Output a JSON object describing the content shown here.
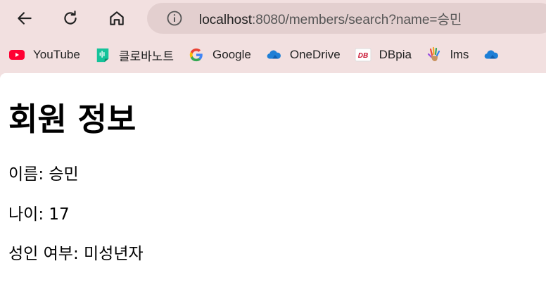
{
  "browser": {
    "url_host": "localhost",
    "url_rest": ":8080/members/search?name=승민"
  },
  "bookmarks": [
    {
      "label": "YouTube",
      "icon": "youtube-icon"
    },
    {
      "label": "클로바노트",
      "icon": "clova-note-icon"
    },
    {
      "label": "Google",
      "icon": "google-icon"
    },
    {
      "label": "OneDrive",
      "icon": "onedrive-icon"
    },
    {
      "label": "DBpia",
      "icon": "dbpia-icon"
    },
    {
      "label": "lms",
      "icon": "lms-hand-icon"
    },
    {
      "label": "",
      "icon": "onedrive-icon"
    }
  ],
  "page": {
    "title": "회원 정보",
    "name_line": "이름: 승민",
    "age_line": "나이: 17",
    "adult_line": "성인 여부: 미성년자"
  },
  "colors": {
    "chrome_bg": "#f2e0e0",
    "omnibox_bg": "#e3cfcf",
    "page_bg": "#ffffff"
  }
}
